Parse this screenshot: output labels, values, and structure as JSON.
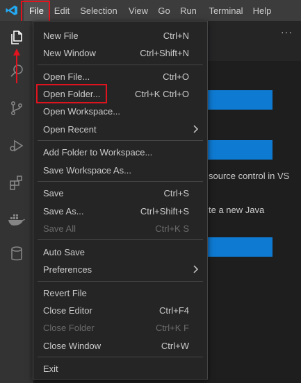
{
  "menubar": {
    "items": [
      {
        "label": "File"
      },
      {
        "label": "Edit"
      },
      {
        "label": "Selection"
      },
      {
        "label": "View"
      },
      {
        "label": "Go"
      },
      {
        "label": "Run"
      },
      {
        "label": "Terminal"
      },
      {
        "label": "Help"
      }
    ],
    "active": "File"
  },
  "activitybar": {
    "icons": [
      "explorer-icon",
      "search-icon",
      "source-control-icon",
      "run-debug-icon",
      "extensions-icon",
      "docker-icon",
      "database-icon"
    ]
  },
  "background": {
    "more_actions": "···",
    "text_1": "source control in VS",
    "text_2": "te a new Java"
  },
  "file_menu": {
    "groups": [
      [
        {
          "label": "New File",
          "shortcut": "Ctrl+N"
        },
        {
          "label": "New Window",
          "shortcut": "Ctrl+Shift+N"
        }
      ],
      [
        {
          "label": "Open File...",
          "shortcut": "Ctrl+O"
        },
        {
          "label": "Open Folder...",
          "shortcut": "Ctrl+K Ctrl+O"
        },
        {
          "label": "Open Workspace...",
          "shortcut": ""
        },
        {
          "label": "Open Recent",
          "shortcut": "",
          "submenu": true
        }
      ],
      [
        {
          "label": "Add Folder to Workspace...",
          "shortcut": ""
        },
        {
          "label": "Save Workspace As...",
          "shortcut": ""
        }
      ],
      [
        {
          "label": "Save",
          "shortcut": "Ctrl+S"
        },
        {
          "label": "Save As...",
          "shortcut": "Ctrl+Shift+S"
        },
        {
          "label": "Save All",
          "shortcut": "Ctrl+K S",
          "disabled": true
        }
      ],
      [
        {
          "label": "Auto Save",
          "shortcut": ""
        },
        {
          "label": "Preferences",
          "shortcut": "",
          "submenu": true
        }
      ],
      [
        {
          "label": "Revert File",
          "shortcut": ""
        },
        {
          "label": "Close Editor",
          "shortcut": "Ctrl+F4"
        },
        {
          "label": "Close Folder",
          "shortcut": "Ctrl+K F",
          "disabled": true
        },
        {
          "label": "Close Window",
          "shortcut": "Ctrl+W"
        }
      ],
      [
        {
          "label": "Exit",
          "shortcut": ""
        }
      ]
    ]
  },
  "colors": {
    "highlight": "#e0141e",
    "accent_blue": "#0e7ad1",
    "menu_bg": "#252526",
    "menubar_bg": "#3c3c3c"
  }
}
